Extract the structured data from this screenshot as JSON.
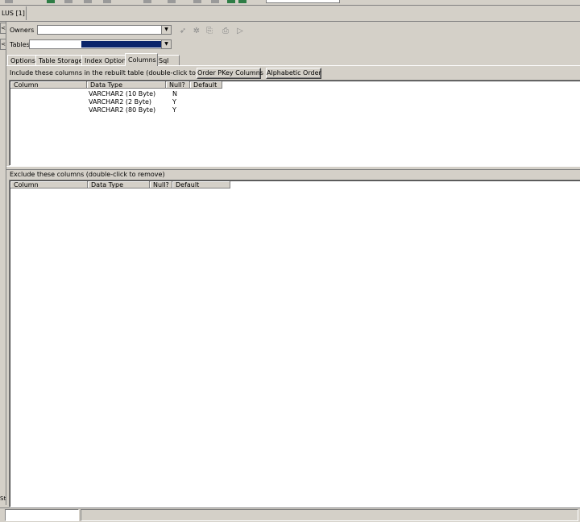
{
  "window": {
    "tab_title": "LUS [1]"
  },
  "gutter": {
    "button_label": "<",
    "status_label": "St"
  },
  "owner": {
    "label": "Owners",
    "value": ""
  },
  "table": {
    "label": "Tables",
    "value": ""
  },
  "tabs": [
    {
      "label": "Options"
    },
    {
      "label": "Table Storage"
    },
    {
      "label": "Index Options"
    },
    {
      "label": "Columns"
    },
    {
      "label": "Sql"
    }
  ],
  "include_section": {
    "caption": "Include these columns in the rebuilt table (double-click to remove)",
    "order_pkey_button": "Order PKey Columns",
    "alphabetic_button": "Alphabetic Order",
    "headers": [
      "Column",
      "Data Type",
      "Null?",
      "Default"
    ],
    "rows": [
      {
        "column": "",
        "data_type": "VARCHAR2 (10 Byte)",
        "null": "N",
        "default": ""
      },
      {
        "column": "",
        "data_type": "VARCHAR2 (2 Byte)",
        "null": "Y",
        "default": ""
      },
      {
        "column": "",
        "data_type": "VARCHAR2 (80 Byte)",
        "null": "Y",
        "default": ""
      }
    ]
  },
  "exclude_section": {
    "caption": "Exclude these columns (double-click to remove)",
    "headers": [
      "Column",
      "Data Type",
      "Null?",
      "Default"
    ],
    "rows": []
  }
}
